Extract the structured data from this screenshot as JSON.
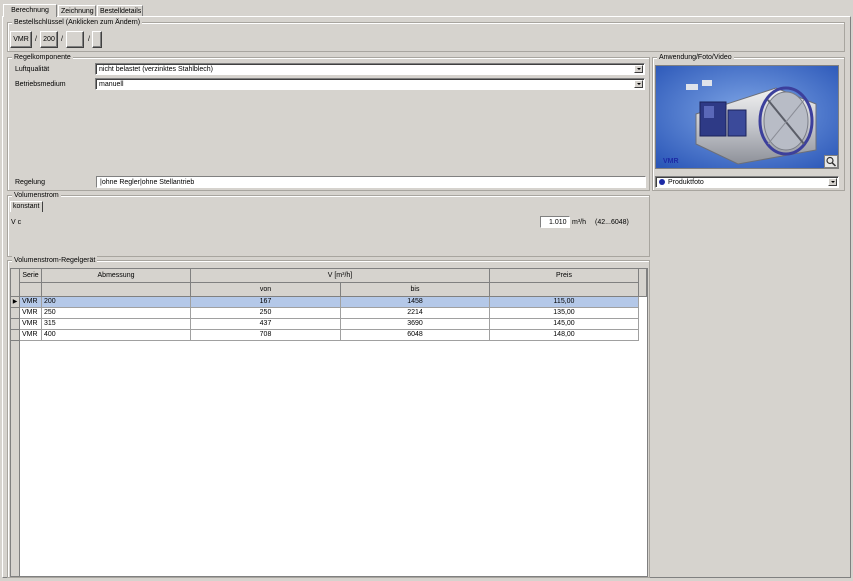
{
  "tabs": [
    {
      "label": "Berechnung",
      "active": true
    },
    {
      "label": "Zeichnung",
      "active": false
    },
    {
      "label": "Bestelldetails",
      "active": false
    }
  ],
  "order_key": {
    "title": "Bestellschlüssel (Anklicken zum Ändern)",
    "buttons": [
      "VMR",
      "200",
      "",
      ""
    ],
    "separators": [
      "/",
      "/",
      "/"
    ]
  },
  "control_component": {
    "title": "Regelkomponente",
    "air_quality_label": "Luftqualität",
    "air_quality_value": "nicht belastet (verzinktes Stahlblech)",
    "medium_label": "Betriebsmedium",
    "medium_value": "manuell",
    "control_label": "Regelung",
    "control_value": "|ohne Regler|ohne Stellantrieb"
  },
  "volume_flow": {
    "title": "Volumenstrom",
    "tab": "konstant",
    "vc_label": "V c",
    "vc_value": "1.010",
    "unit": "m³/h",
    "range": "(42...6048)"
  },
  "regulator": {
    "title": "Volumenstrom-Regelgerät",
    "headers": {
      "serie": "Serie",
      "abmessung": "Abmessung",
      "v": "V [m³/h]",
      "von": "von",
      "bis": "bis",
      "preis": "Preis"
    },
    "rows": [
      {
        "serie": "VMR",
        "abmessung": "200",
        "von": "167",
        "bis": "1458",
        "preis": "115,00",
        "selected": true
      },
      {
        "serie": "VMR",
        "abmessung": "250",
        "von": "250",
        "bis": "2214",
        "preis": "135,00",
        "selected": false
      },
      {
        "serie": "VMR",
        "abmessung": "315",
        "von": "437",
        "bis": "3690",
        "preis": "145,00",
        "selected": false
      },
      {
        "serie": "VMR",
        "abmessung": "400",
        "von": "708",
        "bis": "6048",
        "preis": "148,00",
        "selected": false
      }
    ]
  },
  "media": {
    "title": "Anwendung/Foto/Video",
    "photo_caption": "VMR",
    "select_value": "Produktfoto"
  },
  "colors": {
    "background": "#d6d3ce",
    "selection": "#b4c8e8",
    "photo_bg": "#3f6cc9",
    "caption": "#1c2aa6"
  }
}
